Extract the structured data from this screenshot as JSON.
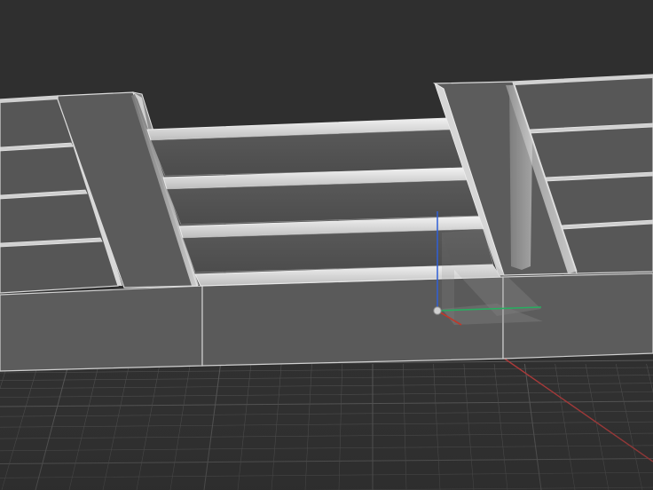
{
  "viewport": {
    "background_color": "#2f2f2f",
    "grid_color": "#505050",
    "grid_major_color": "#585858",
    "mesh_face_color": "#5a5a5a",
    "mesh_light_color": "#d6d6d6",
    "mesh_edge_color": "#e8e8e8",
    "x_axis_color": "#b03a3a",
    "gizmo": {
      "x_color": "#c0392b",
      "y_color": "#27ae60",
      "z_color": "#2f5fd6",
      "pivot_color": "#d0d0d0"
    }
  }
}
